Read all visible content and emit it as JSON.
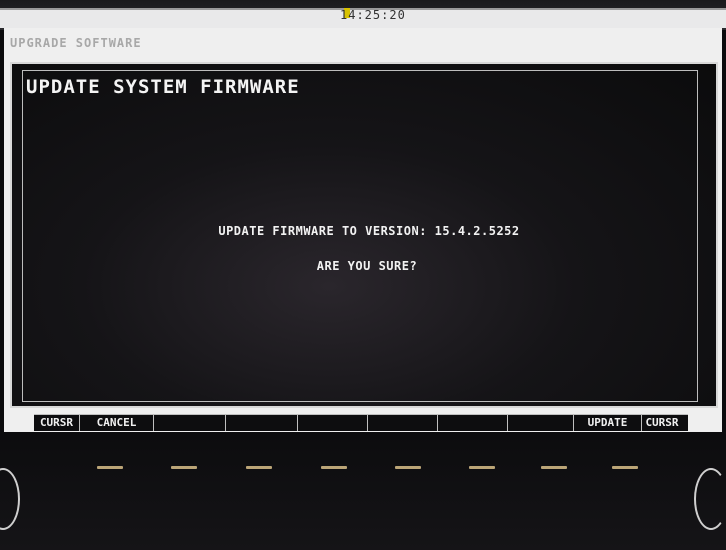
{
  "top_bar": {
    "clock": "14:25:20"
  },
  "screen": {
    "label": "UPGRADE SOFTWARE"
  },
  "dialog": {
    "title": "UPDATE SYSTEM FIRMWARE",
    "message_line1": "UPDATE FIRMWARE TO VERSION: 15.4.2.5252",
    "message_line2": "ARE YOU SURE?"
  },
  "softkeys": [
    {
      "label": "CURSR"
    },
    {
      "label": "CANCEL"
    },
    {
      "label": ""
    },
    {
      "label": ""
    },
    {
      "label": ""
    },
    {
      "label": ""
    },
    {
      "label": ""
    },
    {
      "label": ""
    },
    {
      "label": "UPDATE"
    },
    {
      "label": "CURSR"
    }
  ]
}
